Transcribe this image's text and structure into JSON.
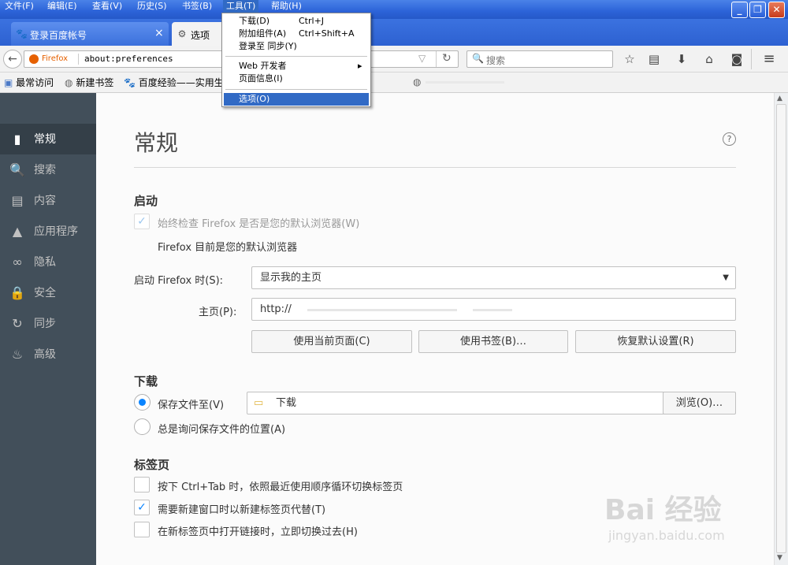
{
  "menubar": [
    "文件(F)",
    "编辑(E)",
    "查看(V)",
    "历史(S)",
    "书签(B)",
    "工具(T)",
    "帮助(H)"
  ],
  "window_buttons": {
    "minimize": "_",
    "restore": "❐",
    "close": "✕"
  },
  "tabs": [
    {
      "title": "登录百度帐号",
      "close": "×"
    },
    {
      "title": "选项"
    }
  ],
  "tools_menu": {
    "items": [
      {
        "label": "下载(D)",
        "shortcut": "Ctrl+J"
      },
      {
        "label": "附加组件(A)",
        "shortcut": "Ctrl+Shift+A"
      },
      {
        "label": "登录至 同步(Y)",
        "shortcut": ""
      },
      {
        "label": "Web 开发者",
        "shortcut": "▸"
      },
      {
        "label": "页面信息(I)",
        "shortcut": ""
      },
      {
        "label": "选项(O)",
        "shortcut": ""
      }
    ]
  },
  "navbar": {
    "identity": "Firefox",
    "url": "about:preferences",
    "search_placeholder": "搜索"
  },
  "bookmarks": [
    "最常访问",
    "新建书签",
    "百度经验——实用生"
  ],
  "sidebar": {
    "items": [
      {
        "label": "常规",
        "icon": "general-icon"
      },
      {
        "label": "搜索",
        "icon": "search-icon"
      },
      {
        "label": "内容",
        "icon": "content-icon"
      },
      {
        "label": "应用程序",
        "icon": "applications-icon"
      },
      {
        "label": "隐私",
        "icon": "privacy-mask-icon"
      },
      {
        "label": "安全",
        "icon": "lock-icon"
      },
      {
        "label": "同步",
        "icon": "sync-icon"
      },
      {
        "label": "高级",
        "icon": "advanced-icon"
      }
    ]
  },
  "main": {
    "title": "常规",
    "help": "?",
    "startup": {
      "heading": "启动",
      "default_check": "始终检查 Firefox 是否是您的默认浏览器(W)",
      "default_status": "Firefox 目前是您的默认浏览器",
      "when_starts_label": "启动 Firefox 时(S):",
      "when_starts_value": "显示我的主页",
      "homepage_label": "主页(P):",
      "homepage_value": "http://",
      "btn_current": "使用当前页面(C)",
      "btn_bookmark": "使用书签(B)…",
      "btn_restore": "恢复默认设置(R)"
    },
    "downloads": {
      "heading": "下载",
      "save_to_label": "保存文件至(V)",
      "folder": "下载",
      "browse": "浏览(O)…",
      "always_ask": "总是询问保存文件的位置(A)"
    },
    "tabs": {
      "heading": "标签页",
      "ctrl_tab": "按下 Ctrl+Tab 时，依照最近使用顺序循环切换标签页",
      "open_new_windows": "需要新建窗口时以新建标签页代替(T)",
      "switch_to_tab": "在新标签页中打开链接时，立即切换过去(H)"
    }
  },
  "watermark": {
    "logo": "Bai 经验",
    "url": "jingyan.baidu.com"
  },
  "colors": {
    "accent": "#0a84ff",
    "sidebar": "#424f5a",
    "xp_blue": "#2c63d8"
  }
}
